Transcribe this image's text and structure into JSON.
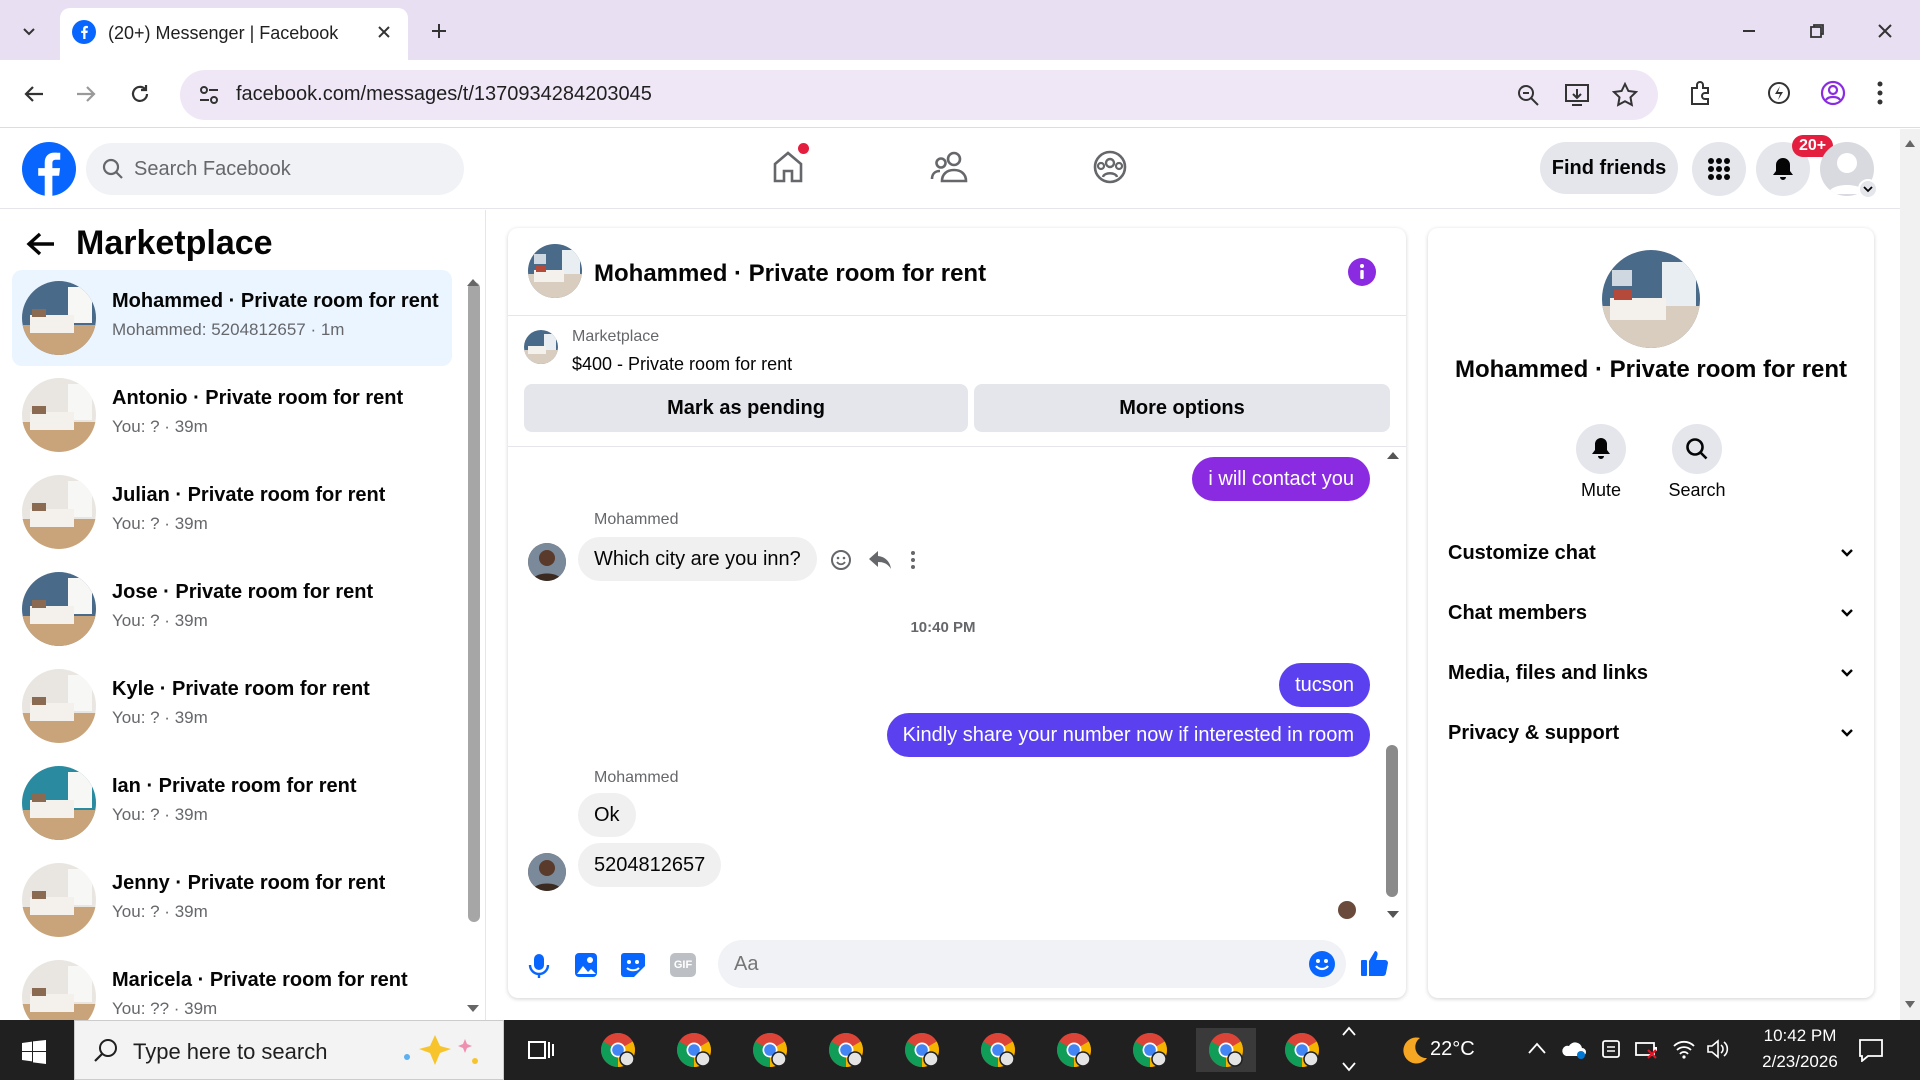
{
  "browser": {
    "tab_title": "(20+) Messenger | Facebook",
    "url": "facebook.com/messages/t/1370934284203045"
  },
  "fb_header": {
    "search_placeholder": "Search Facebook",
    "find_friends": "Find friends",
    "notification_badge": "20+"
  },
  "sidebar": {
    "title": "Marketplace",
    "conversations": [
      {
        "name": "Mohammed · Private room for rent",
        "sub": "Mohammed: 5204812657 · 1m",
        "active": true
      },
      {
        "name": "Antonio · Private room for rent",
        "sub": "You: ? · 39m"
      },
      {
        "name": "Julian · Private room for rent",
        "sub": "You: ? · 39m"
      },
      {
        "name": "Jose · Private room for rent",
        "sub": "You: ? · 39m"
      },
      {
        "name": "Kyle · Private room for rent",
        "sub": "You: ? · 39m"
      },
      {
        "name": "Ian · Private room for rent",
        "sub": "You: ? · 39m"
      },
      {
        "name": "Jenny · Private room for rent",
        "sub": "You: ? · 39m"
      },
      {
        "name": "Maricela · Private room for rent",
        "sub": "You: ?? · 39m"
      }
    ]
  },
  "chat": {
    "title": "Mohammed · Private room for rent",
    "marketplace_label": "Marketplace",
    "listing": "$400 - Private room for rent",
    "mark_pending": "Mark as pending",
    "more_options": "More options",
    "messages": {
      "m1": "i will contact you",
      "sender1": "Mohammed",
      "m2": "Which city are you inn?",
      "timestamp": "10:40 PM",
      "m3": "tucson",
      "m4": "Kindly share your number now if interested in room",
      "sender2": "Mohammed",
      "m5": "Ok",
      "m6": "5204812657"
    },
    "input_placeholder": "Aa"
  },
  "right_panel": {
    "title": "Mohammed · Private room for rent",
    "mute": "Mute",
    "search": "Search",
    "sections": [
      "Customize chat",
      "Chat members",
      "Media, files and links",
      "Privacy & support"
    ]
  },
  "taskbar": {
    "search_placeholder": "Type here to search",
    "weather": "22°C",
    "time": "10:42 PM",
    "date": "2/23/2026"
  },
  "colors": {
    "fb_blue": "#0866ff",
    "outgoing_purple": "#8a2be2",
    "outgoing_blue": "#5b40f0",
    "info_purple": "#8a2be2"
  }
}
